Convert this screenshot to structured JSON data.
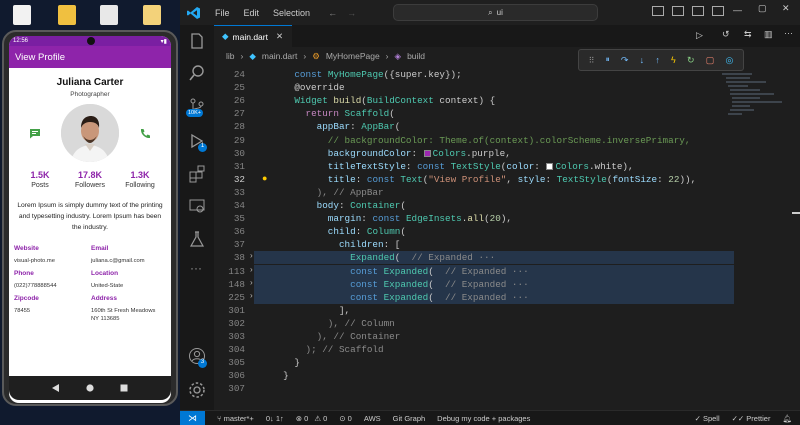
{
  "window": {
    "menu": [
      "File",
      "Edit",
      "Selection"
    ],
    "search": "ui"
  },
  "phone": {
    "status_time": "12:56",
    "appbar_title": "View Profile",
    "name": "Juliana Carter",
    "role": "Photographer",
    "stats": [
      {
        "value": "1.5K",
        "label": "Posts"
      },
      {
        "value": "17.8K",
        "label": "Followers"
      },
      {
        "value": "1.3K",
        "label": "Following"
      }
    ],
    "bio": "Lorem Ipsum is simply dummy text of the printing and typesetting industry. Lorem Ipsum has been the industry.",
    "info": [
      {
        "label": "Website",
        "value": "visual-photo.me"
      },
      {
        "label": "Email",
        "value": "juliana.c@gmail.com"
      },
      {
        "label": "Phone",
        "value": "(022)778888544"
      },
      {
        "label": "Location",
        "value": "United-State"
      },
      {
        "label": "Zipcode",
        "value": "78455"
      },
      {
        "label": "Address",
        "value": "160th St Fresh Meadows NY 113685"
      }
    ]
  },
  "editor": {
    "tab": "main.dart",
    "breadcrumb": [
      "lib",
      "main.dart",
      "MyHomePage",
      "build"
    ],
    "activity_badges": {
      "source_control": "10K+",
      "run_debug": "1",
      "accounts": "3"
    }
  },
  "code_lines": [
    {
      "n": "24",
      "parts": [
        [
          "    ",
          ""
        ],
        [
          "const ",
          "kw"
        ],
        [
          "MyHomePage",
          "ty"
        ],
        [
          "({super.key});",
          ""
        ]
      ]
    },
    {
      "n": "25",
      "parts": [
        [
          "    @override",
          ""
        ]
      ]
    },
    {
      "n": "26",
      "parts": [
        [
          "    ",
          ""
        ],
        [
          "Widget ",
          "ty"
        ],
        [
          "build",
          "fn"
        ],
        [
          "(",
          ""
        ],
        [
          "BuildContext ",
          "ty"
        ],
        [
          "context",
          ""
        ],
        [
          ") {",
          ""
        ]
      ]
    },
    {
      "n": "27",
      "parts": [
        [
          "      ",
          ""
        ],
        [
          "return ",
          "ctrl"
        ],
        [
          "Scaffold",
          "ty"
        ],
        [
          "(",
          ""
        ]
      ]
    },
    {
      "n": "28",
      "parts": [
        [
          "        ",
          ""
        ],
        [
          "appBar",
          "pr"
        ],
        [
          ": ",
          ""
        ],
        [
          "AppBar",
          "ty"
        ],
        [
          "(",
          ""
        ]
      ]
    },
    {
      "n": "29",
      "parts": [
        [
          "          ",
          ""
        ],
        [
          "// backgroundColor: Theme.of(context).colorScheme.inversePrimary,",
          "cm"
        ]
      ]
    },
    {
      "n": "30",
      "parts": [
        [
          "          ",
          ""
        ],
        [
          "backgroundColor",
          "pr"
        ],
        [
          ": ",
          ""
        ],
        [
          "@#9c27b0",
          ""
        ],
        [
          "Colors",
          "ty"
        ],
        [
          ".purple,",
          ""
        ]
      ]
    },
    {
      "n": "31",
      "parts": [
        [
          "          ",
          ""
        ],
        [
          "titleTextStyle",
          "pr"
        ],
        [
          ": ",
          ""
        ],
        [
          "const ",
          "kw"
        ],
        [
          "TextStyle",
          "ty"
        ],
        [
          "(",
          ""
        ],
        [
          "color",
          "pr"
        ],
        [
          ": ",
          ""
        ],
        [
          "@#ffffff",
          ""
        ],
        [
          "Colors",
          "ty"
        ],
        [
          ".white),",
          ""
        ]
      ]
    },
    {
      "n": "32",
      "cur": true,
      "parts": [
        [
          "          ",
          ""
        ],
        [
          "title",
          "pr"
        ],
        [
          ": ",
          ""
        ],
        [
          "const ",
          "kw"
        ],
        [
          "Text",
          "ty"
        ],
        [
          "(",
          ""
        ],
        [
          "\"View Profile\"",
          "st"
        ],
        [
          ", ",
          ""
        ],
        [
          "style",
          "pr"
        ],
        [
          ": ",
          ""
        ],
        [
          "TextStyle",
          "ty"
        ],
        [
          "(",
          ""
        ],
        [
          "fontSize",
          "pr"
        ],
        [
          ": ",
          ""
        ],
        [
          "22",
          "nm"
        ],
        [
          ")),",
          ""
        ]
      ]
    },
    {
      "n": "33",
      "parts": [
        [
          "        ",
          ""
        ],
        [
          "), // AppBar",
          "dim"
        ]
      ]
    },
    {
      "n": "34",
      "parts": [
        [
          "        ",
          ""
        ],
        [
          "body",
          "pr"
        ],
        [
          ": ",
          ""
        ],
        [
          "Container",
          "ty"
        ],
        [
          "(",
          ""
        ]
      ]
    },
    {
      "n": "35",
      "parts": [
        [
          "          ",
          ""
        ],
        [
          "margin",
          "pr"
        ],
        [
          ": ",
          ""
        ],
        [
          "const ",
          "kw"
        ],
        [
          "EdgeInsets",
          "ty"
        ],
        [
          ".",
          ""
        ],
        [
          "all",
          "fn"
        ],
        [
          "(",
          ""
        ],
        [
          "20",
          "nm"
        ],
        [
          "),",
          ""
        ]
      ]
    },
    {
      "n": "36",
      "parts": [
        [
          "          ",
          ""
        ],
        [
          "child",
          "pr"
        ],
        [
          ": ",
          ""
        ],
        [
          "Column",
          "ty"
        ],
        [
          "(",
          ""
        ]
      ]
    },
    {
      "n": "37",
      "parts": [
        [
          "            ",
          ""
        ],
        [
          "children",
          "pr"
        ],
        [
          ": [",
          ""
        ]
      ]
    },
    {
      "n": "38",
      "fold": true,
      "parts": [
        [
          "              ",
          ""
        ],
        [
          "Expanded",
          "ty"
        ],
        [
          "(  ",
          ""
        ],
        [
          "// Expanded ···",
          "dim"
        ]
      ]
    },
    {
      "n": "113",
      "fold": true,
      "parts": [
        [
          "              ",
          ""
        ],
        [
          "const ",
          "kw"
        ],
        [
          "Expanded",
          "ty"
        ],
        [
          "(  ",
          ""
        ],
        [
          "// Expanded ···",
          "dim"
        ]
      ]
    },
    {
      "n": "148",
      "fold": true,
      "parts": [
        [
          "              ",
          ""
        ],
        [
          "const ",
          "kw"
        ],
        [
          "Expanded",
          "ty"
        ],
        [
          "(  ",
          ""
        ],
        [
          "// Expanded ···",
          "dim"
        ]
      ]
    },
    {
      "n": "225",
      "fold": true,
      "parts": [
        [
          "              ",
          ""
        ],
        [
          "const ",
          "kw"
        ],
        [
          "Expanded",
          "ty"
        ],
        [
          "(  ",
          ""
        ],
        [
          "// Expanded ···",
          "dim"
        ]
      ]
    },
    {
      "n": "301",
      "parts": [
        [
          "            ",
          ""
        ],
        [
          "],",
          ""
        ]
      ]
    },
    {
      "n": "302",
      "parts": [
        [
          "          ",
          ""
        ],
        [
          "), // Column",
          "dim"
        ]
      ]
    },
    {
      "n": "303",
      "parts": [
        [
          "        ",
          ""
        ],
        [
          "), // Container",
          "dim"
        ]
      ]
    },
    {
      "n": "304",
      "parts": [
        [
          "      ",
          ""
        ],
        [
          "); // Scaffold",
          "dim"
        ]
      ]
    },
    {
      "n": "305",
      "parts": [
        [
          "    }",
          ""
        ]
      ]
    },
    {
      "n": "306",
      "parts": [
        [
          "  }",
          ""
        ]
      ]
    },
    {
      "n": "307",
      "parts": [
        [
          "",
          ""
        ]
      ]
    }
  ],
  "statusbar": {
    "branch": "master*+",
    "sync": "0↓ 1↑",
    "errors": "0",
    "warnings": "0",
    "ports": "0",
    "aws": "AWS",
    "gitgraph": "Git Graph",
    "debug": "Debug my code + packages",
    "spell": "Spell",
    "prettier": "Prettier"
  },
  "colors": {
    "purple": "#8e24aa",
    "accent": "#0078d4"
  }
}
